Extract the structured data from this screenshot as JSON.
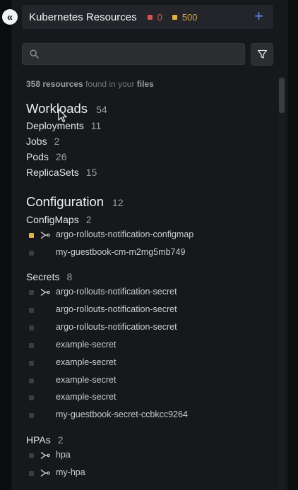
{
  "header": {
    "title": "Kubernetes Resources",
    "errors": "0",
    "warnings": "500",
    "add_label": "+"
  },
  "collapse_label": "«",
  "search": {
    "value": "",
    "placeholder": ""
  },
  "summary": {
    "count": "358 resources",
    "middle": " found in your ",
    "files": "files"
  },
  "colors": {
    "error": "#d6534f",
    "warning": "#e3b341",
    "accent": "#5b8cf0"
  },
  "workloads": {
    "title": "Workloads",
    "count": "54",
    "kinds": [
      {
        "label": "Deployments",
        "count": "11"
      },
      {
        "label": "Jobs",
        "count": "2"
      },
      {
        "label": "Pods",
        "count": "26"
      },
      {
        "label": "ReplicaSets",
        "count": "15"
      }
    ]
  },
  "configuration": {
    "title": "Configuration",
    "count": "12",
    "configmaps": {
      "label": "ConfigMaps",
      "count": "2",
      "items": [
        {
          "name": "argo-rollouts-notification-configmap",
          "status": "warning",
          "linked": true
        },
        {
          "name": "my-guestbook-cm-m2mg5mb749",
          "status": "none",
          "linked": false
        }
      ]
    },
    "secrets": {
      "label": "Secrets",
      "count": "8",
      "items": [
        {
          "name": "argo-rollouts-notification-secret",
          "linked": true
        },
        {
          "name": "argo-rollouts-notification-secret",
          "linked": false
        },
        {
          "name": "argo-rollouts-notification-secret",
          "linked": false
        },
        {
          "name": "example-secret",
          "linked": false
        },
        {
          "name": "example-secret",
          "linked": false
        },
        {
          "name": "example-secret",
          "linked": false
        },
        {
          "name": "example-secret",
          "linked": false
        },
        {
          "name": "my-guestbook-secret-ccbkcc9264",
          "linked": false
        }
      ]
    },
    "hpas": {
      "label": "HPAs",
      "count": "2",
      "items": [
        {
          "name": "hpa",
          "linked": true
        },
        {
          "name": "my-hpa",
          "linked": true
        }
      ]
    }
  }
}
